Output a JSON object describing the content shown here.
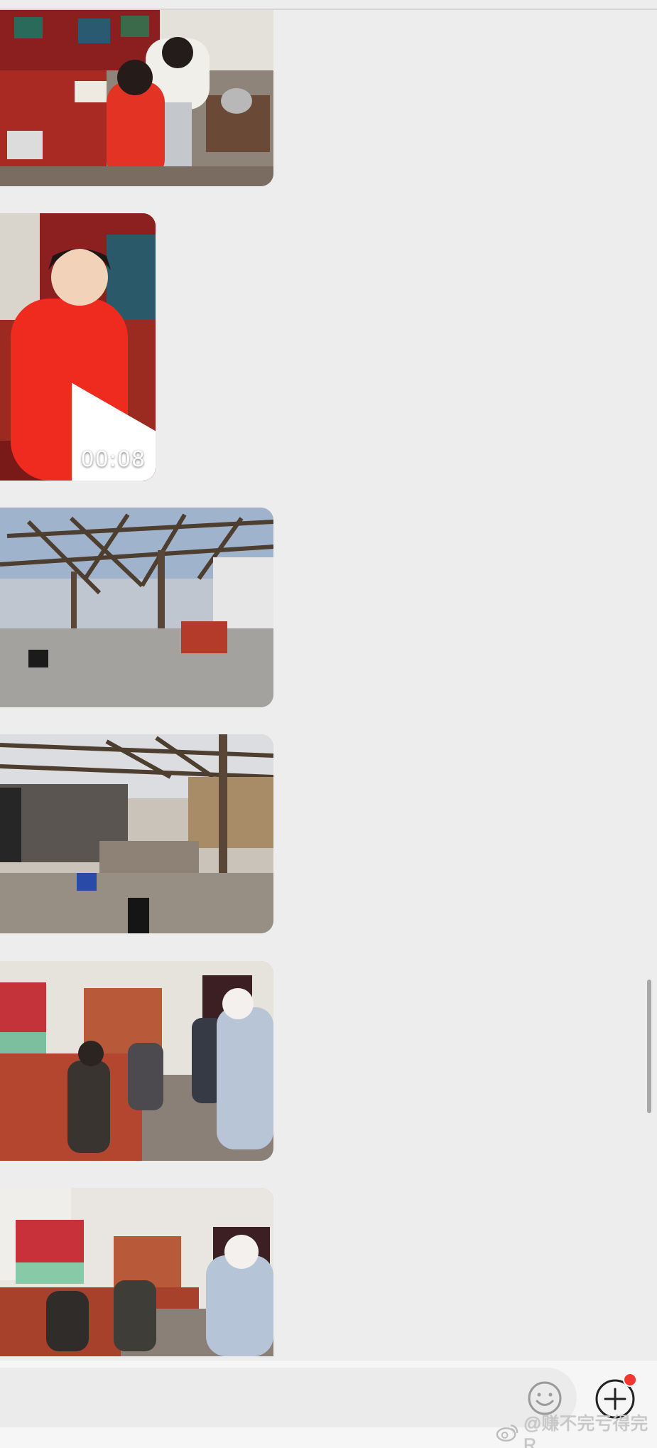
{
  "chat": {
    "messages": [
      {
        "type": "image",
        "subject": "child-red-coat-with-woman"
      },
      {
        "type": "video",
        "duration": "00:08"
      },
      {
        "type": "image",
        "subject": "wooden-pergola-yard"
      },
      {
        "type": "image",
        "subject": "pergola-yard-wall"
      },
      {
        "type": "image",
        "subject": "room-with-children"
      },
      {
        "type": "image",
        "subject": "room-with-children-2"
      }
    ]
  },
  "input_bar": {
    "emoji_icon": "smiley-face-icon",
    "plus_icon": "plus-circle-icon",
    "badge_color": "#f43530"
  },
  "watermark": {
    "text": "@赚不完亏得完R",
    "logo": "weibo-logo"
  },
  "colors": {
    "background": "#ededed",
    "play_icon": "#ffffff"
  }
}
